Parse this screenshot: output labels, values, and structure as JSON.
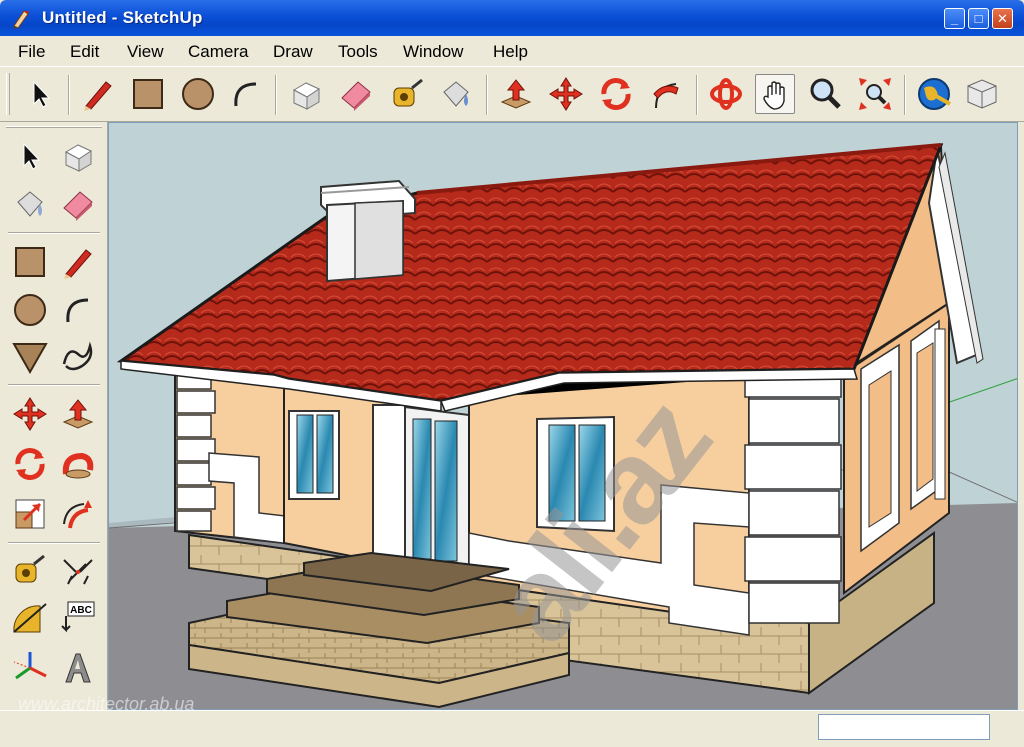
{
  "window": {
    "title": "Untitled - SketchUp",
    "min_label": "_",
    "max_label": "□",
    "close_label": "✕"
  },
  "menu": {
    "items": [
      "File",
      "Edit",
      "View",
      "Camera",
      "Draw",
      "Tools",
      "Window",
      "Help"
    ]
  },
  "toolbar_top": {
    "tools": [
      "select",
      "line",
      "rectangle",
      "circle",
      "arc",
      "make-component",
      "eraser",
      "tape-measure",
      "paint-bucket",
      "push-pull",
      "move",
      "rotate",
      "follow-me",
      "orbit",
      "pan",
      "zoom",
      "zoom-extents",
      "get-models",
      "share-model"
    ],
    "active": "pan"
  },
  "toolbar_left": {
    "tools": [
      "select",
      "make-component",
      "paint-bucket",
      "eraser",
      "rectangle",
      "line",
      "circle",
      "arc",
      "polygon",
      "freehand",
      "move",
      "push-pull",
      "rotate",
      "follow-me",
      "scale",
      "offset",
      "tape-measure",
      "dimension",
      "protractor",
      "text",
      "axes",
      "3d-text"
    ],
    "text_tool_label": "ABC"
  },
  "viewport": {
    "watermark": "ali.az"
  },
  "status": {
    "watermark_url": "www.architector.ab.ua",
    "measurements_value": ""
  },
  "colors": {
    "titlebar": "#0a4fd6",
    "sky": "#bfd2d6",
    "ground": "#8e8e92",
    "roof": "#b32718",
    "wall": "#f7cf9e",
    "stone": "#dcc89e",
    "trim": "#ffffff"
  }
}
